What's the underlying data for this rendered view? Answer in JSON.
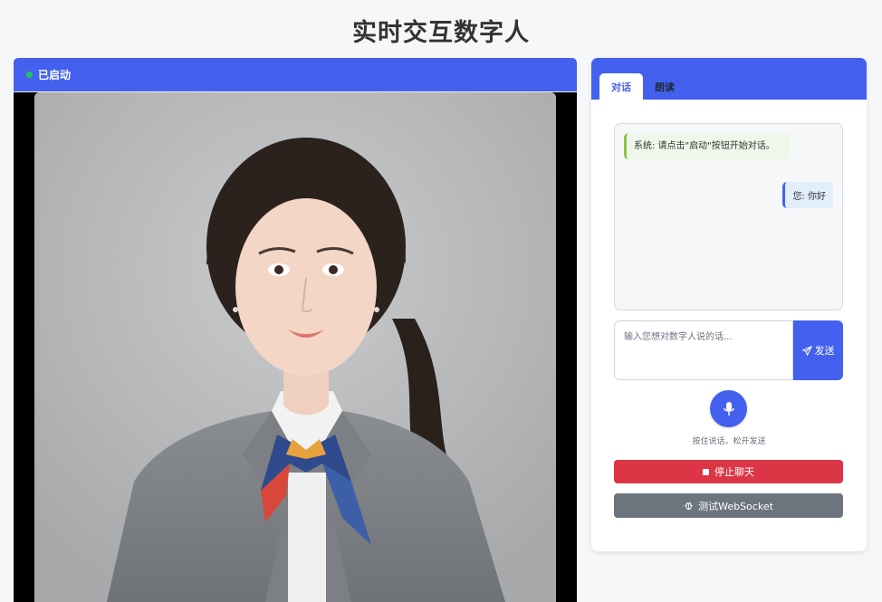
{
  "page": {
    "title": "实时交互数字人"
  },
  "video": {
    "status_label": "已启动",
    "status_color": "#22c55e",
    "header_color": "#4361ee",
    "avatar_icon": "digital-human-portrait"
  },
  "chat": {
    "tabs": [
      {
        "label": "对话",
        "active": true
      },
      {
        "label": "朗读",
        "active": false
      }
    ],
    "messages": [
      {
        "role": "system",
        "text": "系统: 请点击\"启动\"按钮开始对话。"
      },
      {
        "role": "user",
        "text": "您: 你好"
      }
    ],
    "input": {
      "placeholder": "输入您想对数字人说的话...",
      "value": ""
    },
    "send_label": "发送",
    "send_icon": "paper-plane-icon",
    "mic_icon": "microphone-icon",
    "mic_hint": "按住说话，松开发送",
    "stop_label": "停止聊天",
    "stop_icon": "stop-icon",
    "test_label": "测试WebSocket",
    "test_icon": "bug-icon"
  },
  "colors": {
    "primary": "#4361ee",
    "danger": "#dc3545",
    "secondary": "#6c757d"
  }
}
